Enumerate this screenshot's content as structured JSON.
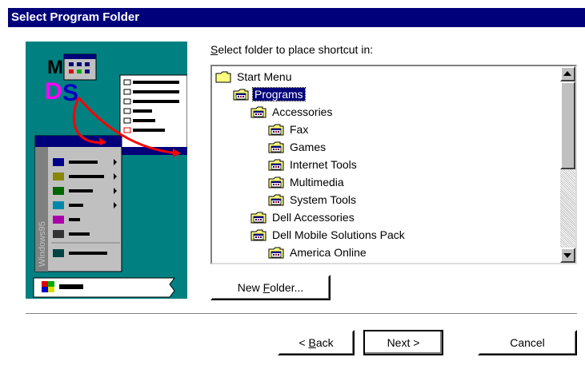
{
  "window": {
    "title": "Select Program Folder"
  },
  "prompt": {
    "before": "",
    "mnemonic": "S",
    "after": "elect folder to place shortcut in:"
  },
  "tree": {
    "items": [
      {
        "label": "Start Menu",
        "level": 0,
        "icon": "folder-icon",
        "selected": false
      },
      {
        "label": "Programs",
        "level": 1,
        "icon": "program-group-icon",
        "selected": true
      },
      {
        "label": "Accessories",
        "level": 2,
        "icon": "program-group-icon",
        "selected": false
      },
      {
        "label": "Fax",
        "level": 3,
        "icon": "program-group-icon",
        "selected": false
      },
      {
        "label": "Games",
        "level": 3,
        "icon": "program-group-icon",
        "selected": false
      },
      {
        "label": "Internet Tools",
        "level": 3,
        "icon": "program-group-icon",
        "selected": false
      },
      {
        "label": "Multimedia",
        "level": 3,
        "icon": "program-group-icon",
        "selected": false
      },
      {
        "label": "System Tools",
        "level": 3,
        "icon": "program-group-icon",
        "selected": false
      },
      {
        "label": "Dell Accessories",
        "level": 2,
        "icon": "program-group-icon",
        "selected": false
      },
      {
        "label": "Dell Mobile Solutions Pack",
        "level": 2,
        "icon": "program-group-icon",
        "selected": false
      },
      {
        "label": "America Online",
        "level": 3,
        "icon": "program-group-icon",
        "selected": false
      }
    ]
  },
  "buttons": {
    "new_folder": {
      "before": "New ",
      "mnemonic": "F",
      "after": "older..."
    },
    "back": {
      "before": "< ",
      "mnemonic": "B",
      "after": "ack"
    },
    "next": {
      "label": "Next >"
    },
    "cancel": {
      "label": "Cancel"
    }
  },
  "illustration": {
    "side_text": "Windows95",
    "colors": {
      "desktop": "#008080",
      "menu": "#c0c0c0",
      "highlight": "#00007b",
      "arrow": "#ff0000"
    }
  }
}
